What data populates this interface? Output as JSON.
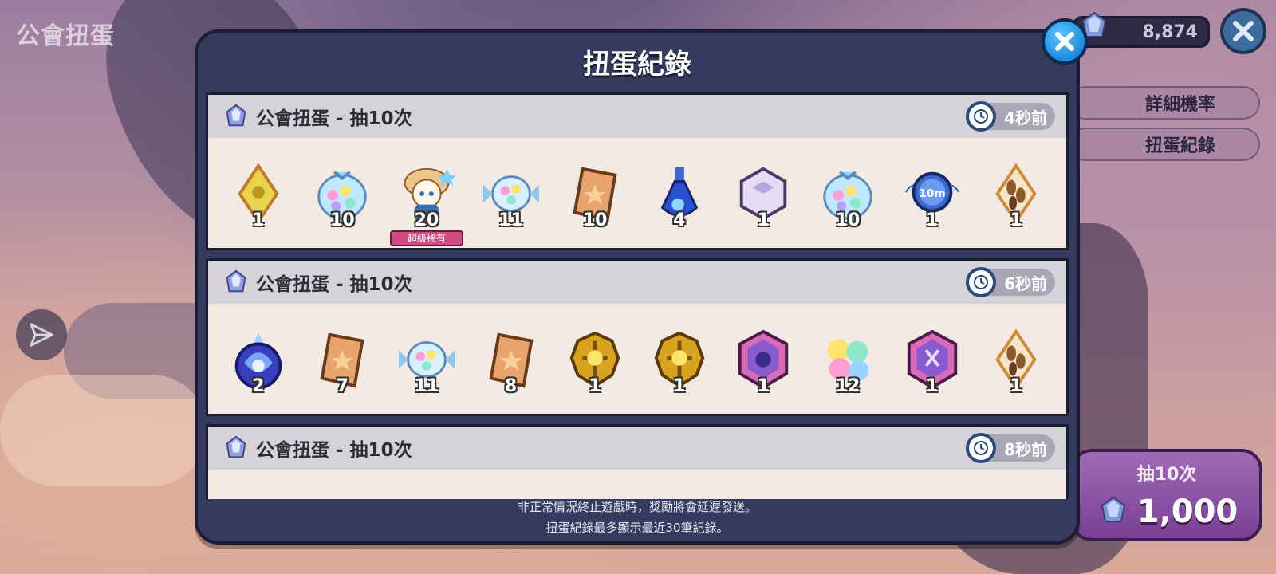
{
  "page_title": "公會扭蛋",
  "currency": {
    "amount": "8,874"
  },
  "side_buttons": {
    "detail_rates": "詳細機率",
    "draw_history": "扭蛋紀錄"
  },
  "draw_button": {
    "label": "抽10次",
    "price": "1,000"
  },
  "modal": {
    "title": "扭蛋紀錄",
    "footer_line1": "非正常情況終止遊戲時，獎勵將會延遲發送。",
    "footer_line2": "扭蛋紀錄最多顯示最近30筆紀錄。",
    "records": [
      {
        "title": "公會扭蛋 - 抽10次",
        "time": "4秒前",
        "items": [
          {
            "icon": "yellow-rune-icon",
            "qty": "1"
          },
          {
            "icon": "candy-bag-icon",
            "qty": "10"
          },
          {
            "icon": "cookie-character-icon",
            "qty": "20",
            "tag": "超級稀有"
          },
          {
            "icon": "candy-wrapped-icon",
            "qty": "11"
          },
          {
            "icon": "star-biscuit-icon",
            "qty": "10"
          },
          {
            "icon": "blue-potion-icon",
            "qty": "4"
          },
          {
            "icon": "crystal-cube-icon",
            "qty": "1"
          },
          {
            "icon": "candy-bag-icon",
            "qty": "10"
          },
          {
            "icon": "timer-10m-icon",
            "qty": "1"
          },
          {
            "icon": "seed-rune-icon",
            "qty": "1"
          }
        ]
      },
      {
        "title": "公會扭蛋 - 抽10次",
        "time": "6秒前",
        "items": [
          {
            "icon": "blue-flame-potion-icon",
            "qty": "2"
          },
          {
            "icon": "star-biscuit-icon",
            "qty": "7"
          },
          {
            "icon": "candy-wrapped-icon",
            "qty": "11"
          },
          {
            "icon": "star-biscuit-icon",
            "qty": "8"
          },
          {
            "icon": "gold-emblem-icon",
            "qty": "1"
          },
          {
            "icon": "gold-emblem-icon",
            "qty": "1"
          },
          {
            "icon": "purple-hex-badge-icon",
            "qty": "1"
          },
          {
            "icon": "candy-flowers-icon",
            "qty": "12"
          },
          {
            "icon": "purple-hex-badge-icon",
            "qty": "1"
          },
          {
            "icon": "seed-rune-icon",
            "qty": "1"
          }
        ]
      },
      {
        "title": "公會扭蛋 - 抽10次",
        "time": "8秒前",
        "items": []
      }
    ]
  }
}
